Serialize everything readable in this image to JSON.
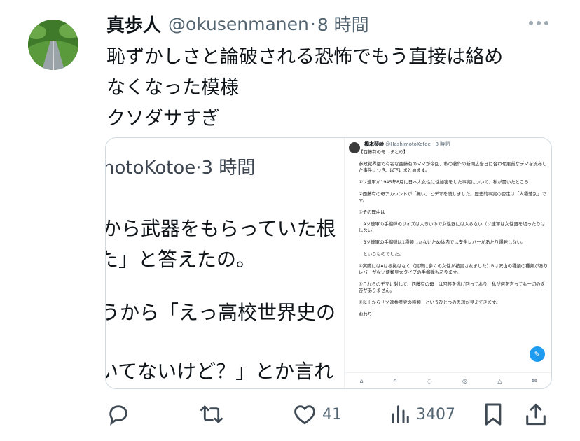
{
  "tweet": {
    "display_name": "真歩人",
    "handle": "@okusenmanen",
    "separator": "·",
    "time": "8 時間",
    "text_lines": [
      "恥ずかしさと論破される恐怖でもう直接は絡め",
      "なくなった模様",
      "クソダサすぎ"
    ]
  },
  "attached_images": {
    "left": {
      "lines": [
        "hotoKotoe·3 時間",
        "から武器をもらっていた根",
        "た」と答えたの。",
        "うから「えっ高校世界史の",
        "いてないけど？」とか言れ"
      ]
    },
    "right": {
      "author": "橋本琴絵",
      "handle": "@HashimotoKotoe · 8 時間",
      "paragraphs": [
        "【西藤有の母　まとめ】",
        "参政党界隈で有名な西藤有のママが今回、私の著作の新聞広告日に合わせ悪質なデマを流布した事件につき、以下にまとめます。",
        "①ソ連軍が1945年8月に日本人女性に性加害をした事実について、私が書いたところ",
        "②西藤有の母アカウントが「無い」とデマを流しました。歴史的事実の否定は「人種差別」です。",
        "③その理由は",
        "　Aソ連軍の手榴弾のサイズは大きいので女性器には入らない（ソ連軍は女性器を切ったりはしない）",
        "　Bソ連軍の手榴弾は1種類しかないため体内では安全レバーがあたり爆発しない。",
        "　というものでした。",
        "④実際にはAは根拠はなく（実際に多くの女性が被害されました）Bは沢山の種類の種類がありレバーがない便類見大タイプの手榴弾もあります。",
        "⑤これらのデマに対して、西藤有の母　は回答を逃げ回っており、私が何を言っても一切の返答がありません。",
        "⑥以上から「ソ連共産党の種類」というひとつの思想が見えてきます。",
        "おわり"
      ]
    }
  },
  "actions": {
    "reply_count": "",
    "retweet_count": "",
    "like_count": "41",
    "view_count": "3407"
  },
  "icons": [
    "more-icon",
    "reply-icon",
    "retweet-icon",
    "like-icon",
    "views-icon",
    "bookmark-icon",
    "share-icon"
  ]
}
